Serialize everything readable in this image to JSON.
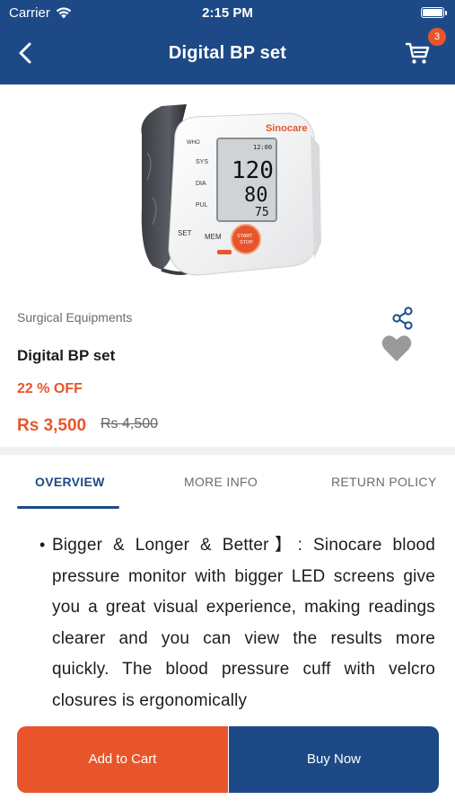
{
  "status_bar": {
    "carrier": "Carrier",
    "time": "2:15 PM"
  },
  "header": {
    "title": "Digital BP set",
    "cart_count": "3"
  },
  "product_image": {
    "brand": "Sinocare",
    "who_label": "WHO",
    "sys_label": "SYS",
    "dia_label": "DIA",
    "pul_label": "PUL",
    "screen_time": "12:00",
    "sys_value": "120",
    "dia_value": "80",
    "pul_value": "75",
    "set_label": "SET",
    "mem_label": "MEM",
    "start_label": "START",
    "stop_label": "STOP"
  },
  "product": {
    "category": "Surgical Equipments",
    "name": "Digital BP set",
    "discount": "22 % OFF",
    "price": "Rs 3,500",
    "old_price": "Rs 4,500"
  },
  "tabs": [
    {
      "label": "OVERVIEW"
    },
    {
      "label": "MORE INFO"
    },
    {
      "label": "RETURN POLICY"
    }
  ],
  "overview": {
    "bullet": "•",
    "text": "Bigger & Longer & Better】: Sinocare blood pressure monitor with bigger LED screens give you a great visual experience, making readings clearer and you can view the results more quickly. The blood pressure cuff with velcro closures is ergonomically"
  },
  "actions": {
    "add_to_cart": "Add to Cart",
    "buy_now": "Buy Now"
  },
  "colors": {
    "primary": "#1d4a86",
    "accent": "#e8552a"
  }
}
